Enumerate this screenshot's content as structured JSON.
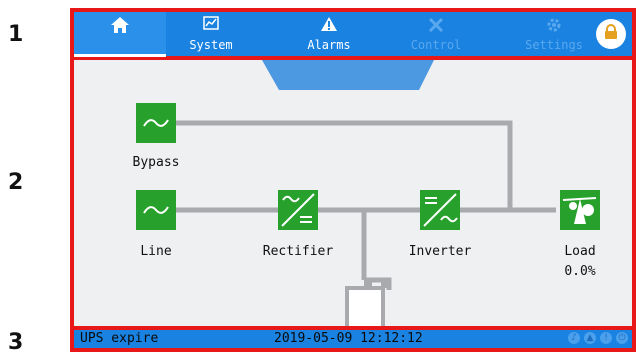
{
  "annotations": {
    "row1": "1",
    "row2": "2",
    "row3": "3"
  },
  "nav": {
    "home_icon": "home-icon",
    "tabs": [
      {
        "label": "System",
        "icon": "chart-icon",
        "enabled": true
      },
      {
        "label": "Alarms",
        "icon": "warning-icon",
        "enabled": true
      },
      {
        "label": "Control",
        "icon": "wrench-icon",
        "enabled": false
      },
      {
        "label": "Settings",
        "icon": "gear-icon",
        "enabled": false
      }
    ],
    "lock_icon": "lock-icon"
  },
  "diagram": {
    "nodes": {
      "bypass": {
        "label": "Bypass",
        "icon": "sine-wave-icon"
      },
      "line": {
        "label": "Line",
        "icon": "sine-wave-icon"
      },
      "rectifier": {
        "label": "Rectifier",
        "icon": "ac-dc-icon"
      },
      "inverter": {
        "label": "Inverter",
        "icon": "dc-ac-icon"
      },
      "load": {
        "label": "Load",
        "icon": "load-icon",
        "value": "0.0%"
      }
    },
    "colors": {
      "node": "#27a12b",
      "line": "#a8aaad",
      "battery_fill": "#ffffff"
    }
  },
  "status": {
    "message": "UPS expire",
    "datetime": "2019-05-09 12:12:12",
    "icons": [
      "sound-icon",
      "alarm-icon",
      "fault-icon",
      "power-icon"
    ]
  },
  "colors": {
    "accent": "#1a82e0",
    "highlight_border": "#e81818"
  }
}
